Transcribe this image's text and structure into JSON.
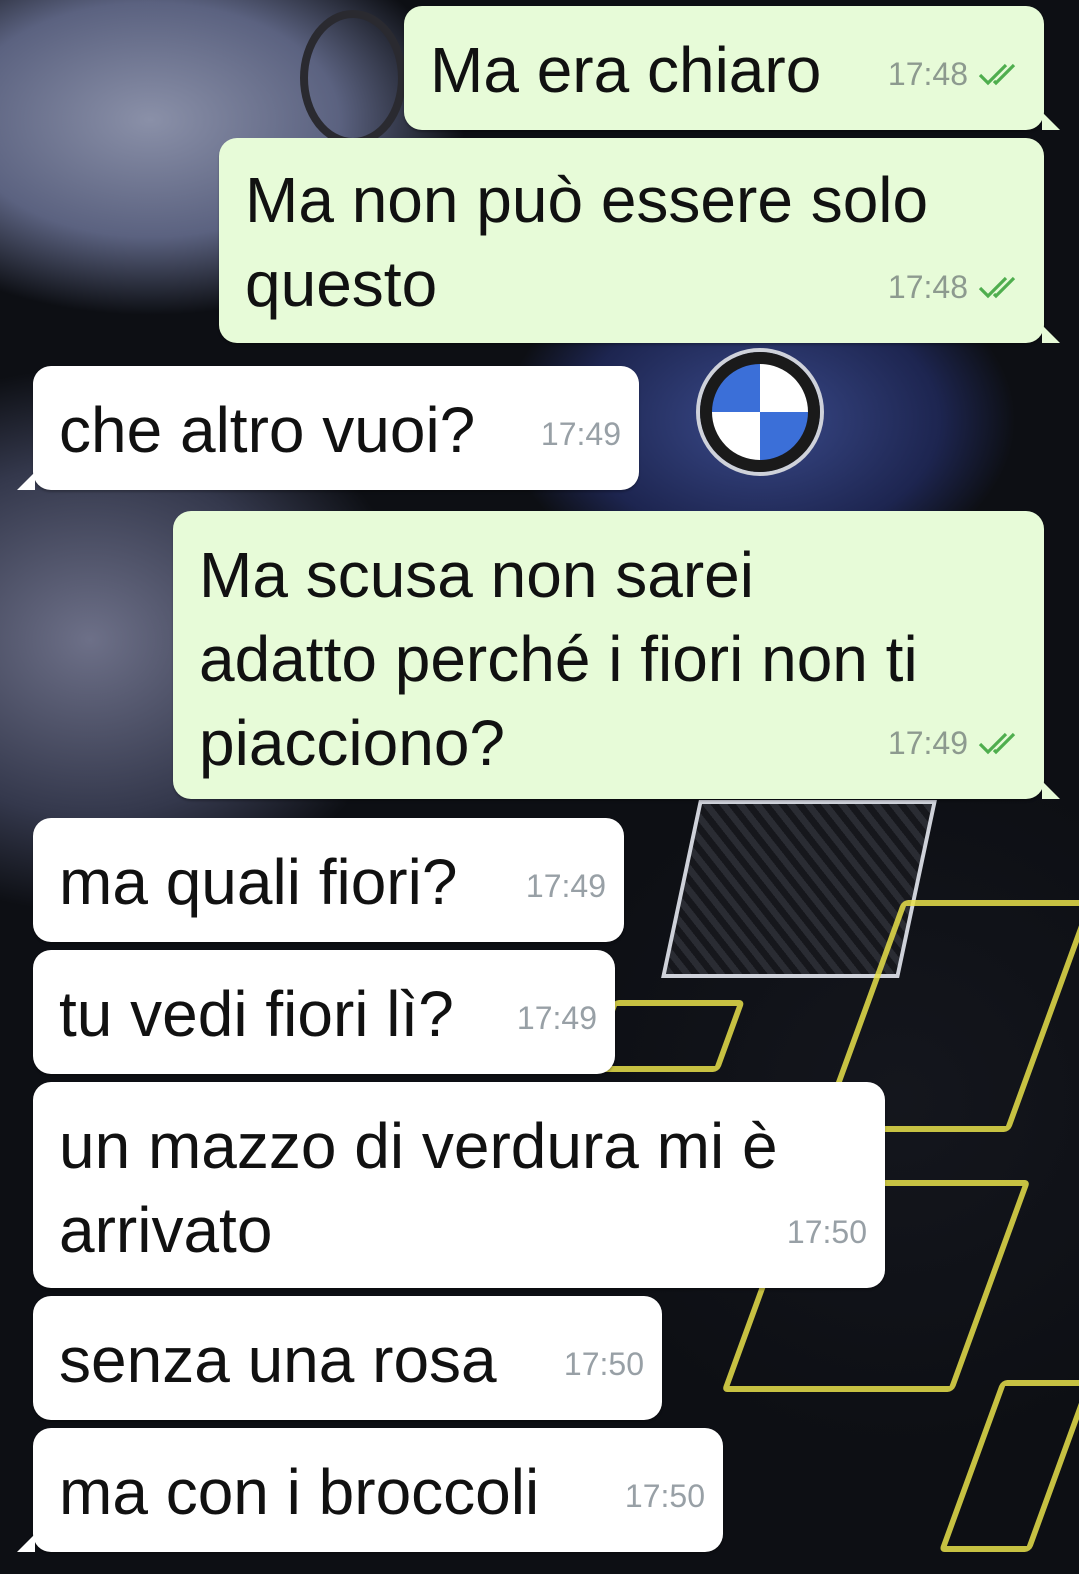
{
  "colors": {
    "outgoing_bubble": "#e7fbd8",
    "incoming_bubble": "#ffffff",
    "read_ticks": "#4fae4e"
  },
  "messages": [
    {
      "direction": "out",
      "text": "Ma era chiaro",
      "time": "17:48",
      "status_icon": "double-check-icon"
    },
    {
      "direction": "out",
      "text": "Ma non può essere solo\nquesto",
      "time": "17:48",
      "status_icon": "double-check-icon"
    },
    {
      "direction": "in",
      "text": "che altro vuoi?",
      "time": "17:49"
    },
    {
      "direction": "out",
      "text": "Ma scusa non sarei\nadatto perché i fiori non ti\npiacciono?",
      "time": "17:49",
      "status_icon": "double-check-icon"
    },
    {
      "direction": "in",
      "text": "ma quali fiori?",
      "time": "17:49"
    },
    {
      "direction": "in",
      "text": "tu vedi fiori lì?",
      "time": "17:49"
    },
    {
      "direction": "in",
      "text": "un mazzo di verdura mi è\narrivato",
      "time": "17:50"
    },
    {
      "direction": "in",
      "text": "senza una rosa",
      "time": "17:50"
    },
    {
      "direction": "in",
      "text": "ma con i broccoli",
      "time": "17:50"
    }
  ]
}
